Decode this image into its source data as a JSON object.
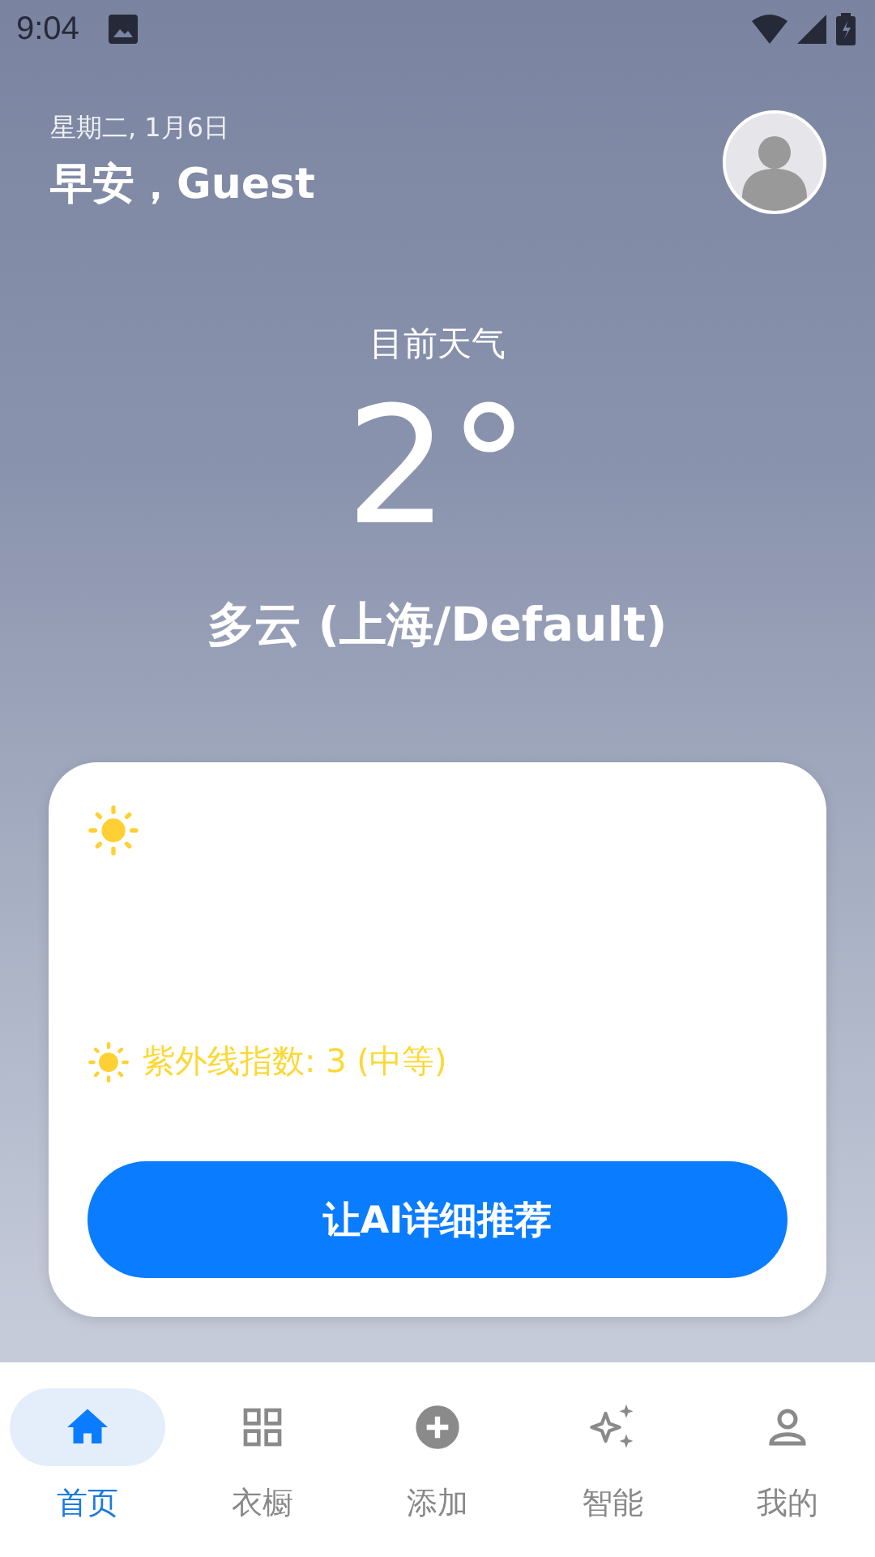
{
  "status_bar": {
    "time": "9:04"
  },
  "header": {
    "date": "星期二, 1月6日",
    "greeting": "早安，Guest"
  },
  "weather": {
    "label": "目前天气",
    "temperature": "2°",
    "condition": "多云 (上海/Default)"
  },
  "card": {
    "uv_text": "紫外线指数: 3 (中等)",
    "button": "让AI详细推荐"
  },
  "nav": [
    {
      "kind": "home",
      "label": "首页",
      "selected": true
    },
    {
      "kind": "wardrobe",
      "label": "衣橱",
      "selected": false
    },
    {
      "kind": "add",
      "label": "添加",
      "selected": false
    },
    {
      "kind": "ai",
      "label": "智能",
      "selected": false
    },
    {
      "kind": "profile",
      "label": "我的",
      "selected": false
    }
  ]
}
